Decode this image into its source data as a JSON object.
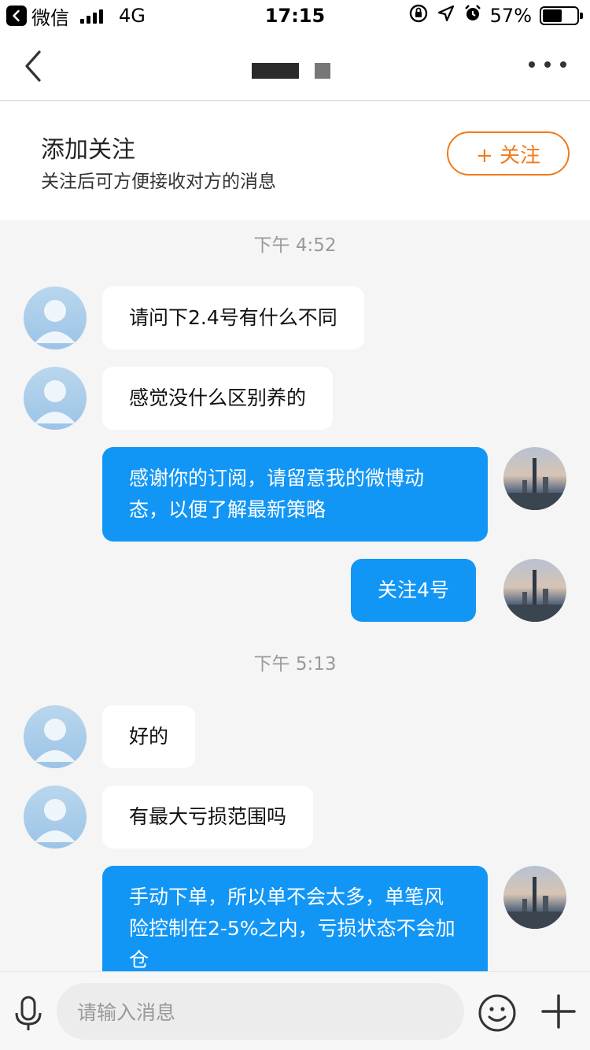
{
  "status_bar": {
    "back_app_label": "微信",
    "network": "4G",
    "time": "17:15",
    "battery_percent": "57%",
    "battery_level": 0.57
  },
  "navbar": {
    "back_icon": "chevron-left-icon",
    "more_icon": "more-dots-icon"
  },
  "follow_panel": {
    "title": "添加关注",
    "subtitle": "关注后可方便接收对方的消息",
    "button_label": "+ 关注"
  },
  "chat": {
    "time_1": "下午 4:52",
    "time_2": "下午 5:13",
    "messages": [
      {
        "side": "in",
        "text": "请问下2.4号有什么不同"
      },
      {
        "side": "in",
        "text": "感觉没什么区别养的"
      },
      {
        "side": "out",
        "text": "感谢你的订阅，请留意我的微博动态，以便了解最新策略"
      },
      {
        "side": "out",
        "text": "关注4号"
      },
      {
        "side": "in",
        "text": "好的"
      },
      {
        "side": "in",
        "text": "有最大亏损范围吗"
      },
      {
        "side": "out",
        "text": "手动下单，所以单不会太多，单笔风险控制在2-5%之内，亏损状态不会加仓"
      }
    ]
  },
  "input_bar": {
    "placeholder": "请输入消息",
    "mic_icon": "microphone-icon",
    "emoji_icon": "emoji-icon",
    "plus_icon": "plus-icon"
  },
  "colors": {
    "accent_orange": "#f27a1a",
    "bubble_blue": "#1296f5",
    "background": "#f5f5f5"
  }
}
